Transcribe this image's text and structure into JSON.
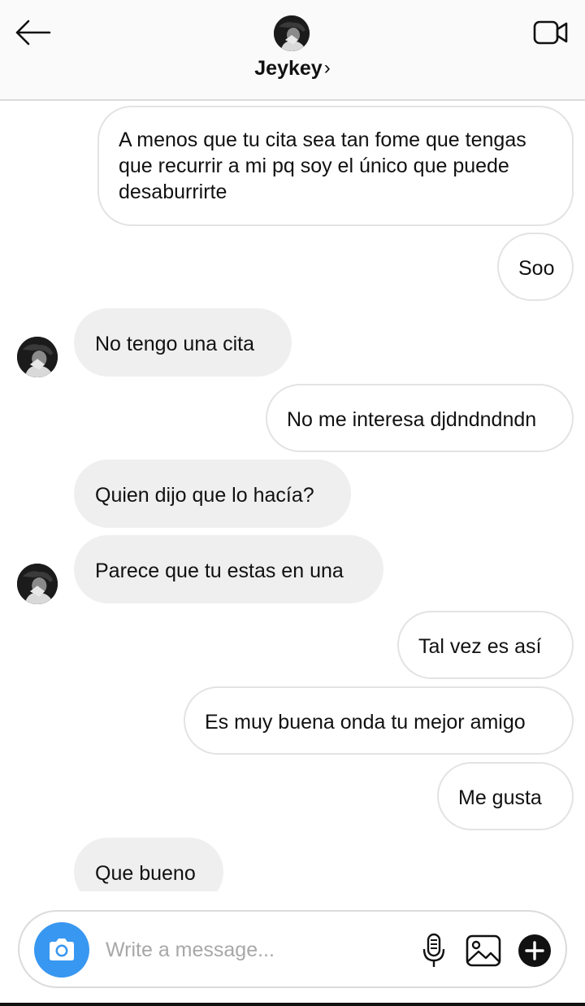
{
  "header": {
    "contact_name": "Jeykey",
    "chevron": "›",
    "icons": {
      "back": "arrow-left-icon",
      "video": "video-camera-icon"
    }
  },
  "messages": [
    {
      "sender": "me",
      "text": "A menos que tu cita sea tan fome que tengas que recurrir a mi pq soy el único que puede desaburrirte"
    },
    {
      "sender": "me",
      "text": "Soo"
    },
    {
      "sender": "contact",
      "text": "No tengo una cita"
    },
    {
      "sender": "me",
      "text": "No me interesa djdndndndn"
    },
    {
      "sender": "contact",
      "text": "Quien dijo que lo hacía?"
    },
    {
      "sender": "contact",
      "text": "Parece que tu estas en una"
    },
    {
      "sender": "me",
      "text": "Tal vez es así"
    },
    {
      "sender": "me",
      "text": "Es muy buena onda tu mejor amigo"
    },
    {
      "sender": "me",
      "text": "Me gusta"
    },
    {
      "sender": "contact",
      "text": "Que bueno"
    }
  ],
  "composer": {
    "placeholder": "Write a message...",
    "value": "",
    "icons": {
      "camera": "camera-icon",
      "mic": "microphone-icon",
      "gallery": "image-gallery-icon",
      "add": "plus-circle-icon"
    }
  },
  "colors": {
    "accent": "#3897f0",
    "received_bubble": "#efefef",
    "sent_border": "#e3e3e3",
    "header_bg": "#fafafa"
  }
}
